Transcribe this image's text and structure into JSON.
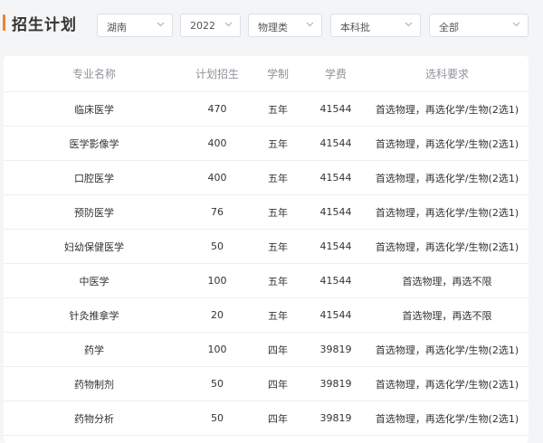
{
  "page": {
    "title": "招生计划"
  },
  "filters": [
    {
      "value": "湖南"
    },
    {
      "value": "2022"
    },
    {
      "value": "物理类"
    },
    {
      "value": "本科批"
    },
    {
      "value": "全部"
    }
  ],
  "table": {
    "headers": [
      "专业名称",
      "计划招生",
      "学制",
      "学费",
      "选科要求"
    ],
    "rows": [
      [
        "临床医学",
        "470",
        "五年",
        "41544",
        "首选物理，再选化学/生物(2选1)"
      ],
      [
        "医学影像学",
        "400",
        "五年",
        "41544",
        "首选物理，再选化学/生物(2选1)"
      ],
      [
        "口腔医学",
        "400",
        "五年",
        "41544",
        "首选物理，再选化学/生物(2选1)"
      ],
      [
        "预防医学",
        "76",
        "五年",
        "41544",
        "首选物理，再选化学/生物(2选1)"
      ],
      [
        "妇幼保健医学",
        "50",
        "五年",
        "41544",
        "首选物理，再选化学/生物(2选1)"
      ],
      [
        "中医学",
        "100",
        "五年",
        "41544",
        "首选物理，再选不限"
      ],
      [
        "针灸推拿学",
        "20",
        "五年",
        "41544",
        "首选物理，再选不限"
      ],
      [
        "药学",
        "100",
        "四年",
        "39819",
        "首选物理，再选化学/生物(2选1)"
      ],
      [
        "药物制剂",
        "50",
        "四年",
        "39819",
        "首选物理，再选化学/生物(2选1)"
      ],
      [
        "药物分析",
        "50",
        "四年",
        "39819",
        "首选物理，再选化学/生物(2选1)"
      ]
    ]
  },
  "icons": {
    "select_chevron": "chevron-down-icon"
  },
  "colors": {
    "accent": "#f0822f",
    "header_text": "#909399",
    "border": "#ebeef5"
  }
}
